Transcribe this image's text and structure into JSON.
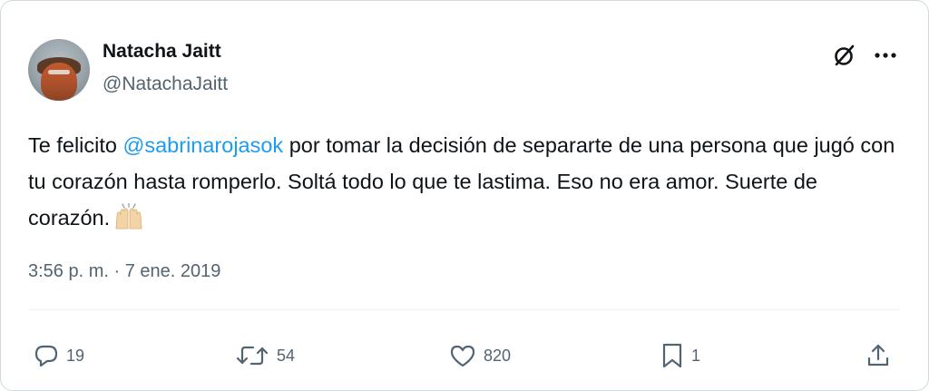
{
  "author": {
    "name": "Natacha Jaitt",
    "handle": "@NatachaJaitt"
  },
  "header_icons": [
    "grok-icon",
    "more-icon"
  ],
  "tweet": {
    "text_before": "Te felicito ",
    "mention": "@sabrinarojasok",
    "text_after": " por tomar la decisión de separarte de una persona que jugó con tu corazón hasta romperlo. Soltá todo lo que te lastima. Eso no era amor. Suerte de corazón.",
    "emoji": "raising-hands-emoji"
  },
  "timestamp": "3:56 p. m. · 7 ene. 2019",
  "actions": {
    "reply": {
      "icon": "reply-icon",
      "count": "19"
    },
    "retweet": {
      "icon": "retweet-icon",
      "count": "54"
    },
    "like": {
      "icon": "heart-icon",
      "count": "820"
    },
    "bookmark": {
      "icon": "bookmark-icon",
      "count": "1"
    },
    "share": {
      "icon": "share-icon"
    }
  },
  "colors": {
    "text": "#0f1419",
    "secondary": "#536471",
    "mention": "#1d9bf0",
    "border": "#cfd9de"
  }
}
